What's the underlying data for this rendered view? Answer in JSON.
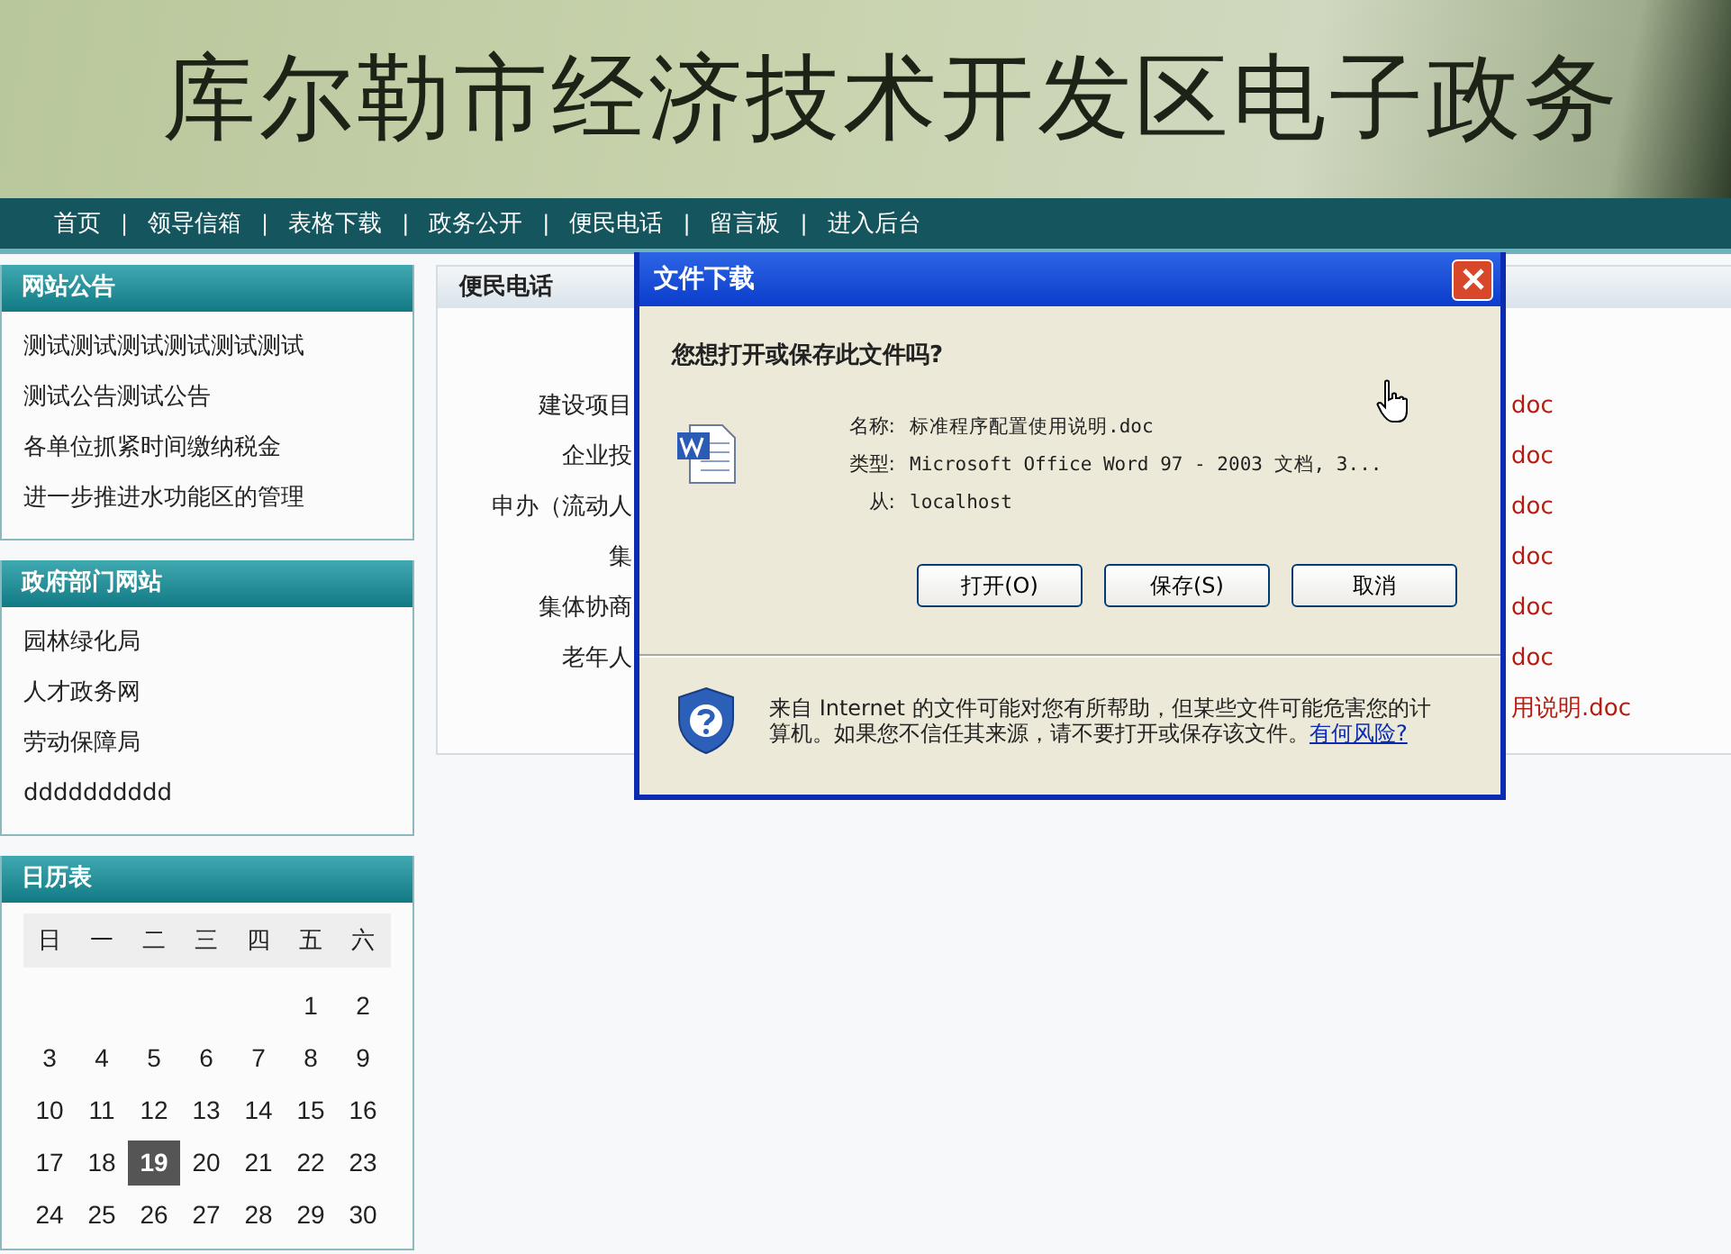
{
  "header": {
    "title": "库尔勒市经济技术开发区电子政务"
  },
  "nav": {
    "separator": "|",
    "items": [
      "首页",
      "领导信箱",
      "表格下载",
      "政务公开",
      "便民电话",
      "留言板",
      "进入后台"
    ]
  },
  "sidebar": [
    {
      "kind": "list",
      "title": "网站公告",
      "items": [
        "测试测试测试测试测试测试",
        "测试公告测试公告",
        "各单位抓紧时间缴纳税金",
        "进一步推进水功能区的管理"
      ]
    },
    {
      "kind": "list",
      "title": "政府部门网站",
      "items": [
        "园林绿化局",
        "人才政务网",
        "劳动保障局",
        "dddddddddd"
      ]
    },
    {
      "kind": "calendar",
      "title": "日历表",
      "weekdays": [
        "日",
        "一",
        "二",
        "三",
        "四",
        "五",
        "六"
      ],
      "weeks": [
        [
          {
            "day": "1",
            "selected": false
          },
          {
            "day": "2",
            "selected": false
          }
        ],
        [
          {
            "day": "3",
            "selected": false
          },
          {
            "day": "4",
            "selected": false
          },
          {
            "day": "5",
            "selected": false
          },
          {
            "day": "6",
            "selected": false
          },
          {
            "day": "7",
            "selected": false
          },
          {
            "day": "8",
            "selected": false
          },
          {
            "day": "9",
            "selected": false
          }
        ],
        [
          {
            "day": "10",
            "selected": false
          },
          {
            "day": "11",
            "selected": false
          },
          {
            "day": "12",
            "selected": false
          },
          {
            "day": "13",
            "selected": false
          },
          {
            "day": "14",
            "selected": false
          },
          {
            "day": "15",
            "selected": false
          },
          {
            "day": "16",
            "selected": false
          }
        ],
        [
          {
            "day": "17",
            "selected": false
          },
          {
            "day": "18",
            "selected": false
          },
          {
            "day": "19",
            "selected": true
          },
          {
            "day": "20",
            "selected": false
          },
          {
            "day": "21",
            "selected": false
          },
          {
            "day": "22",
            "selected": false
          },
          {
            "day": "23",
            "selected": false
          }
        ],
        [
          {
            "day": "24",
            "selected": false
          },
          {
            "day": "25",
            "selected": false
          },
          {
            "day": "26",
            "selected": false
          },
          {
            "day": "27",
            "selected": false
          },
          {
            "day": "28",
            "selected": false
          },
          {
            "day": "29",
            "selected": false
          },
          {
            "day": "30",
            "selected": false
          }
        ]
      ]
    }
  ],
  "content": {
    "title": "便民电话",
    "rows": [
      {
        "label": "建设项目",
        "link": "doc"
      },
      {
        "label": "企业投",
        "link": "doc"
      },
      {
        "label": "申办（流动人",
        "link": "doc"
      },
      {
        "label": "集",
        "link": "doc"
      },
      {
        "label": "集体协商",
        "link": "doc"
      },
      {
        "label": "老年人",
        "link": "doc"
      },
      {
        "link": "用说明.doc"
      }
    ]
  },
  "dialog": {
    "title": "文件下载",
    "question": "您想打开或保存此文件吗?",
    "fields": [
      {
        "label": "名称:",
        "value": "标准程序配置使用说明.doc"
      },
      {
        "label": "类型:",
        "value": "Microsoft Office Word 97 - 2003 文档, 3..."
      },
      {
        "label": "从:",
        "value": "localhost"
      }
    ],
    "buttons": [
      "打开(O)",
      "保存(S)",
      "取消"
    ],
    "warning": "来自 Internet 的文件可能对您有所帮助，但某些文件可能危害您的计算机。如果您不信任其来源，请不要打开或保存该文件。",
    "warning_link": "有何风险?"
  }
}
